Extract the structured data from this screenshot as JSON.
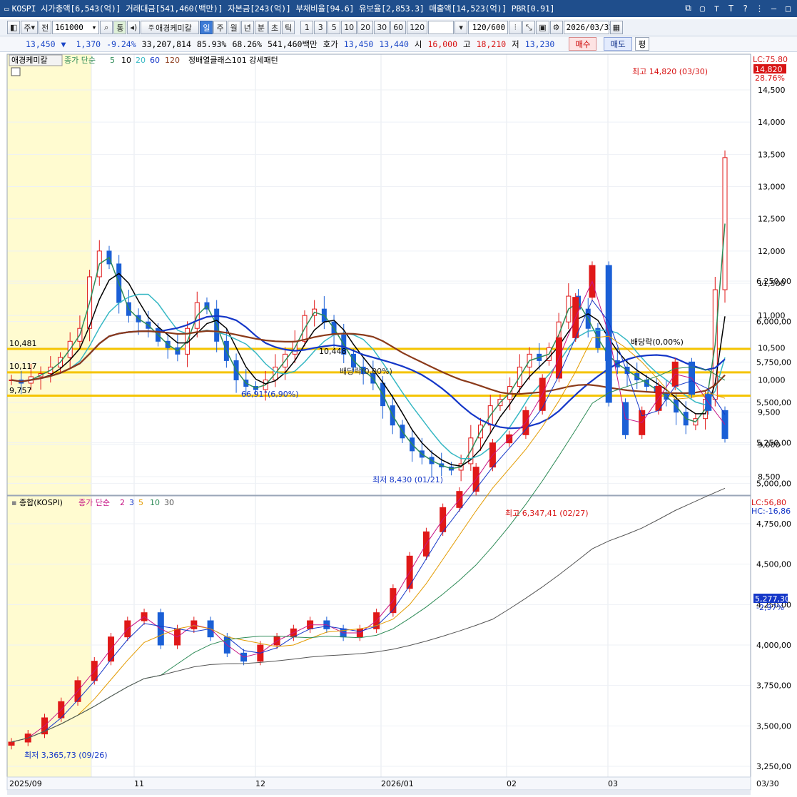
{
  "titlebar": {
    "text": "KOSPI 시가총액[6,543(억)] 거래대금[541,460(백만)] 자본금[243(억)] 부채비율[94.6] 유보율[2,853.3] 매출액[14,523(억)] PBR[0.91]",
    "icons": [
      "window-icon",
      "copy-icon",
      "pin-icon",
      "font-icon",
      "help-icon",
      "dots-icon",
      "minimize-icon",
      "maximize-icon"
    ]
  },
  "toolbar": {
    "type_label": "주",
    "prev_label": "전",
    "code": "161000",
    "name": "애경케미칼",
    "period_tabs": [
      "일",
      "주",
      "월",
      "년",
      "분",
      "초",
      "틱"
    ],
    "active_period": "일",
    "minutes": [
      "1",
      "3",
      "5",
      "10",
      "20",
      "30",
      "60",
      "120"
    ],
    "range": "120",
    "range_total": "/600",
    "date": "2026/03/31"
  },
  "quote": {
    "price": "13,450",
    "arrow": "▼",
    "change": "1,370",
    "change_pct": "-9.24%",
    "volume": "33,207,814",
    "vol_ratio": "85.93%",
    "ratio2": "68.26%",
    "amount": "541,460백만",
    "hoga_label": "호가",
    "ask": "13,450",
    "bid": "13,440",
    "open_label": "시",
    "open": "16,000",
    "high_label": "고",
    "high": "18,210",
    "low_label": "저",
    "low": "13,230",
    "buy": "매수",
    "sell": "매도",
    "p": "평"
  },
  "main_chart": {
    "name": "애경케미칼",
    "legend_ma_label": "종가 단순",
    "ma_periods": [
      "5",
      "10",
      "20",
      "60",
      "120"
    ],
    "ma_colors": [
      "#2e8b57",
      "#000000",
      "#37b8c4",
      "#1537c8",
      "#8b3a1a"
    ],
    "pattern_label": "정배열클래스101 강세패턴",
    "lc": "LC:75.80",
    "last_price": "14,820",
    "last_pct": "28.76%",
    "y_ticks": [
      "14,500",
      "14,000",
      "13,500",
      "13,000",
      "12,500",
      "12,000",
      "11,500",
      "11,000",
      "10,500",
      "10,000",
      "9,500",
      "9,000",
      "8,500"
    ],
    "levels": [
      "10,481",
      "10,117",
      "9,757"
    ],
    "max_label": "최고 14,820 (03/30)",
    "min_label": "최저 8,430 (01/21)",
    "annot1": "66,91°(6,90%)",
    "annot2": "10,448",
    "annot3": "배당락(0,00%)",
    "annot4": "배당락(0,00%)"
  },
  "sub_chart": {
    "name": "종합(KOSPI)",
    "legend_ma_label": "종가 단순",
    "ma_periods": [
      "2",
      "3",
      "5",
      "10",
      "30"
    ],
    "lc": "LC:56,80",
    "hc": "HC:-16,86",
    "last": "5,277,30",
    "last_pct": "-2,97%",
    "y_ticks": [
      "6,250,00",
      "6,000,00",
      "5,750,00",
      "5,500,00",
      "5,250,00",
      "5,000,00",
      "4,750,00",
      "4,500,00",
      "4,250,00",
      "4,000,00",
      "3,750,00",
      "3,500,00",
      "3,250,00"
    ],
    "max_label": "최고 6,347,41 (02/27)",
    "min_label": "최저 3,365,73 (09/26)"
  },
  "x_axis": [
    "2025/09",
    "11",
    "12",
    "2026/01",
    "02",
    "03",
    "03/30"
  ],
  "chart_data": [
    {
      "type": "candlestick",
      "title": "애경케미칼",
      "y_range": [
        8300,
        15000
      ],
      "levels": [
        10481,
        10117,
        9757
      ],
      "approx_close": [
        10000,
        9950,
        10050,
        10100,
        10200,
        10350,
        10600,
        10800,
        11600,
        12000,
        11800,
        11200,
        11000,
        10900,
        10800,
        10600,
        10500,
        10400,
        10800,
        11200,
        11100,
        10600,
        10300,
        10000,
        9900,
        9850,
        10000,
        10200,
        10400,
        10600,
        11000,
        11100,
        10900,
        10700,
        10400,
        10200,
        10100,
        9950,
        9600,
        9300,
        9100,
        8900,
        8800,
        8700,
        8650,
        8600,
        8700,
        9100,
        9300,
        9600,
        9700,
        9900,
        10200,
        10400,
        10300,
        10500,
        10900,
        11300,
        11100,
        10800,
        10500,
        10300,
        10200,
        10100,
        10000,
        9900,
        9800,
        9700,
        9500,
        9300,
        9400,
        9700,
        11400,
        13450
      ]
    },
    {
      "type": "candlestick",
      "title": "종합(KOSPI)",
      "y_range": [
        3200,
        6350
      ],
      "approx_close": [
        3400,
        3450,
        3550,
        3650,
        3780,
        3900,
        4050,
        4150,
        4200,
        4000,
        4100,
        4150,
        4050,
        3950,
        3900,
        4000,
        4050,
        4100,
        4150,
        4100,
        4050,
        4100,
        4200,
        4350,
        4550,
        4700,
        4850,
        4950,
        5100,
        5250,
        5300,
        5450,
        5650,
        5900,
        6150,
        6347,
        5500,
        5300,
        5450,
        5600,
        5750,
        5550,
        5450,
        5277
      ]
    }
  ]
}
